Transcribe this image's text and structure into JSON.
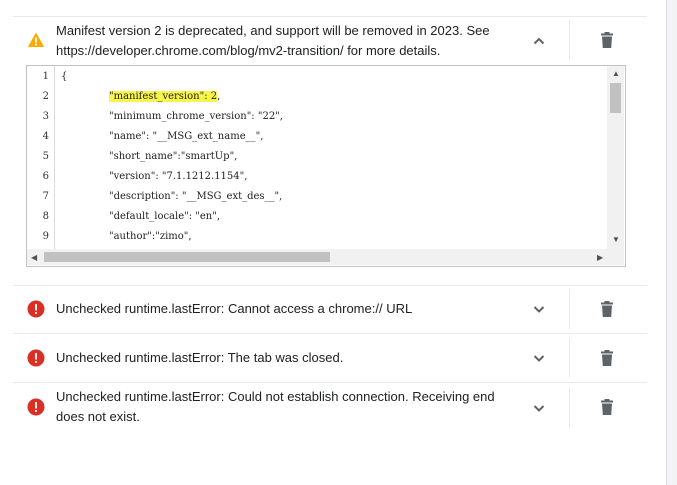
{
  "entries": [
    {
      "severity": "warning",
      "message": "Manifest version 2 is deprecated, and support will be removed in 2023. See https://developer.chrome.com/blog/mv2-transition/ for more details.",
      "expanded": true,
      "chevron_icon": "chevron-up-icon",
      "delete_icon": "trash-icon"
    },
    {
      "severity": "error",
      "message": "Unchecked runtime.lastError: Cannot access a chrome:// URL",
      "expanded": false,
      "chevron_icon": "chevron-down-icon",
      "delete_icon": "trash-icon"
    },
    {
      "severity": "error",
      "message": "Unchecked runtime.lastError: The tab was closed.",
      "expanded": false,
      "chevron_icon": "chevron-down-icon",
      "delete_icon": "trash-icon"
    },
    {
      "severity": "error",
      "message": "Unchecked runtime.lastError: Could not establish connection. Receiving end does not exist.",
      "expanded": false,
      "chevron_icon": "chevron-down-icon",
      "delete_icon": "trash-icon"
    }
  ],
  "code_viewer": {
    "lines": [
      {
        "number": "1",
        "text": "{"
      },
      {
        "number": "2",
        "text": "\"manifest_version\": 2",
        "suffix": ",",
        "highlighted": true
      },
      {
        "number": "3",
        "text": "\"minimum_chrome_version\": \"22\","
      },
      {
        "number": "4",
        "text": "\"name\": \"__MSG_ext_name__\","
      },
      {
        "number": "5",
        "text": "\"short_name\":\"smartUp\","
      },
      {
        "number": "6",
        "text": "\"version\": \"7.1.1212.1154\","
      },
      {
        "number": "7",
        "text": "\"description\": \"__MSG_ext_des__\","
      },
      {
        "number": "8",
        "text": "\"default_locale\": \"en\","
      },
      {
        "number": "9",
        "text": "\"author\":\"zimo\","
      }
    ]
  },
  "colors": {
    "warning": "#f9ab00",
    "error": "#d93025",
    "highlight": "#f7f44a",
    "icon_gray": "#5f6368"
  }
}
